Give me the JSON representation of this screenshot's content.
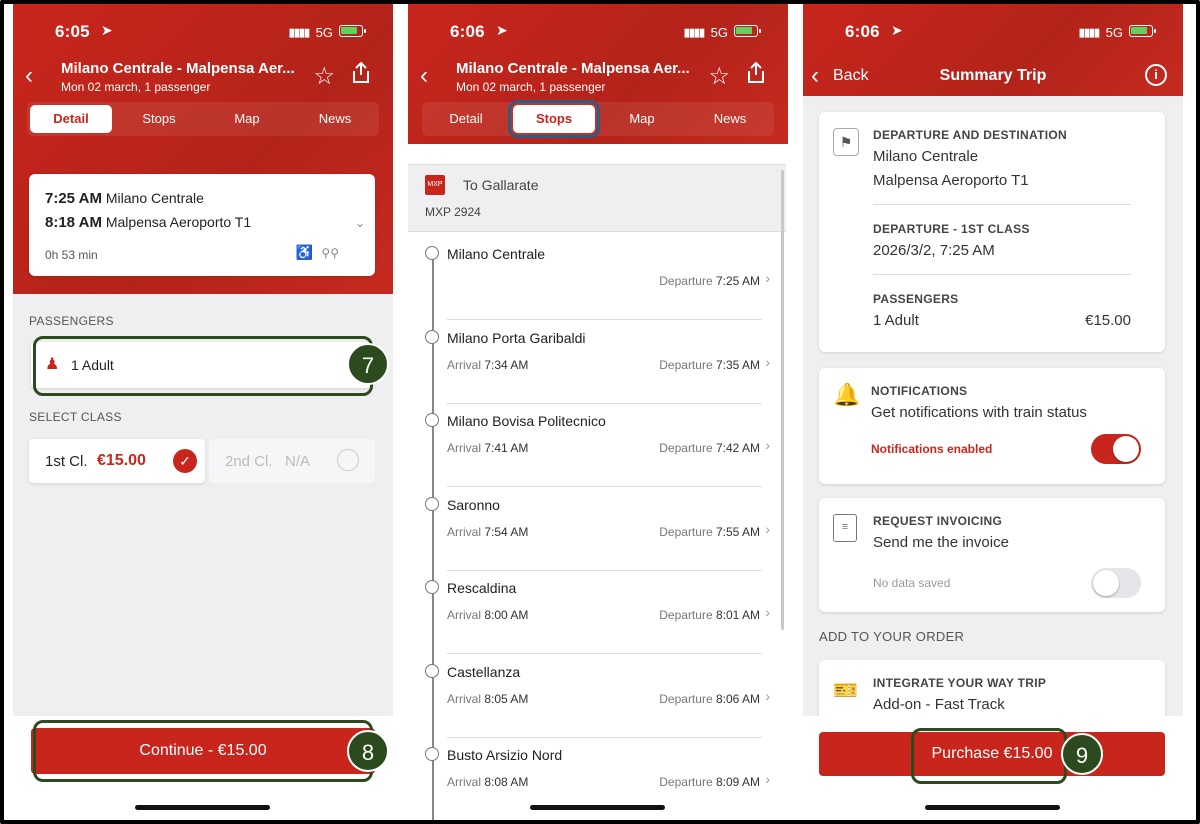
{
  "status": {
    "p1_time": "6:05",
    "p2_time": "6:06",
    "p3_time": "6:06",
    "network": "5G"
  },
  "trip": {
    "title": "Milano Centrale - Malpensa Aer...",
    "subtitle": "Mon 02 march, 1 passenger"
  },
  "tabs": [
    "Detail",
    "Stops",
    "Map",
    "News"
  ],
  "detail": {
    "dep_time": "7:25 AM",
    "dep_station": "Milano Centrale",
    "arr_time": "8:18 AM",
    "arr_station": "Malpensa Aeroporto T1",
    "duration": "0h 53 min",
    "passengers_label": "PASSENGERS",
    "passenger_value": "1 Adult",
    "class_label": "SELECT CLASS",
    "first_class": "1st Cl.",
    "first_price": "€15.00",
    "second_class": "2nd Cl.",
    "second_price": "N/A",
    "continue": "Continue - €15.00"
  },
  "stops_panel": {
    "header_badge": "MXP",
    "header_dest": "To Gallarate",
    "train_code": "MXP 2924",
    "arrival_label": "Arrival",
    "departure_label": "Departure",
    "stops": [
      {
        "name": "Milano Centrale",
        "arrival": "",
        "departure": "7:25 AM"
      },
      {
        "name": "Milano Porta Garibaldi",
        "arrival": "7:34 AM",
        "departure": "7:35 AM"
      },
      {
        "name": "Milano Bovisa Politecnico",
        "arrival": "7:41 AM",
        "departure": "7:42 AM"
      },
      {
        "name": "Saronno",
        "arrival": "7:54 AM",
        "departure": "7:55 AM"
      },
      {
        "name": "Rescaldina",
        "arrival": "8:00 AM",
        "departure": "8:01 AM"
      },
      {
        "name": "Castellanza",
        "arrival": "8:05 AM",
        "departure": "8:06 AM"
      },
      {
        "name": "Busto Arsizio Nord",
        "arrival": "8:08 AM",
        "departure": "8:09 AM"
      }
    ]
  },
  "summary": {
    "back": "Back",
    "title": "Summary Trip",
    "dep_dest_label": "DEPARTURE AND DESTINATION",
    "origin": "Milano Centrale",
    "destination": "Malpensa Aeroporto T1",
    "departure_label": "DEPARTURE - 1ST CLASS",
    "departure_value": "2026/3/2, 7:25 AM",
    "passengers_label": "PASSENGERS",
    "passengers_value": "1 Adult",
    "passengers_price": "€15.00",
    "notif_label": "NOTIFICATIONS",
    "notif_text": "Get notifications with train status",
    "notif_status": "Notifications enabled",
    "invoice_label": "REQUEST INVOICING",
    "invoice_text": "Send me the invoice",
    "invoice_status": "No data saved",
    "add_label": "ADD TO YOUR ORDER",
    "addon_label": "INTEGRATE YOUR WAY TRIP",
    "addon_text": "Add-on - Fast Track",
    "purchase": "Purchase €15.00"
  },
  "callouts": {
    "step7": "7",
    "step8": "8",
    "step9": "9"
  },
  "colors": {
    "brand_red": "#c8261d",
    "callout_green": "#2b4a1e",
    "screen_gray": "#efeff2"
  }
}
